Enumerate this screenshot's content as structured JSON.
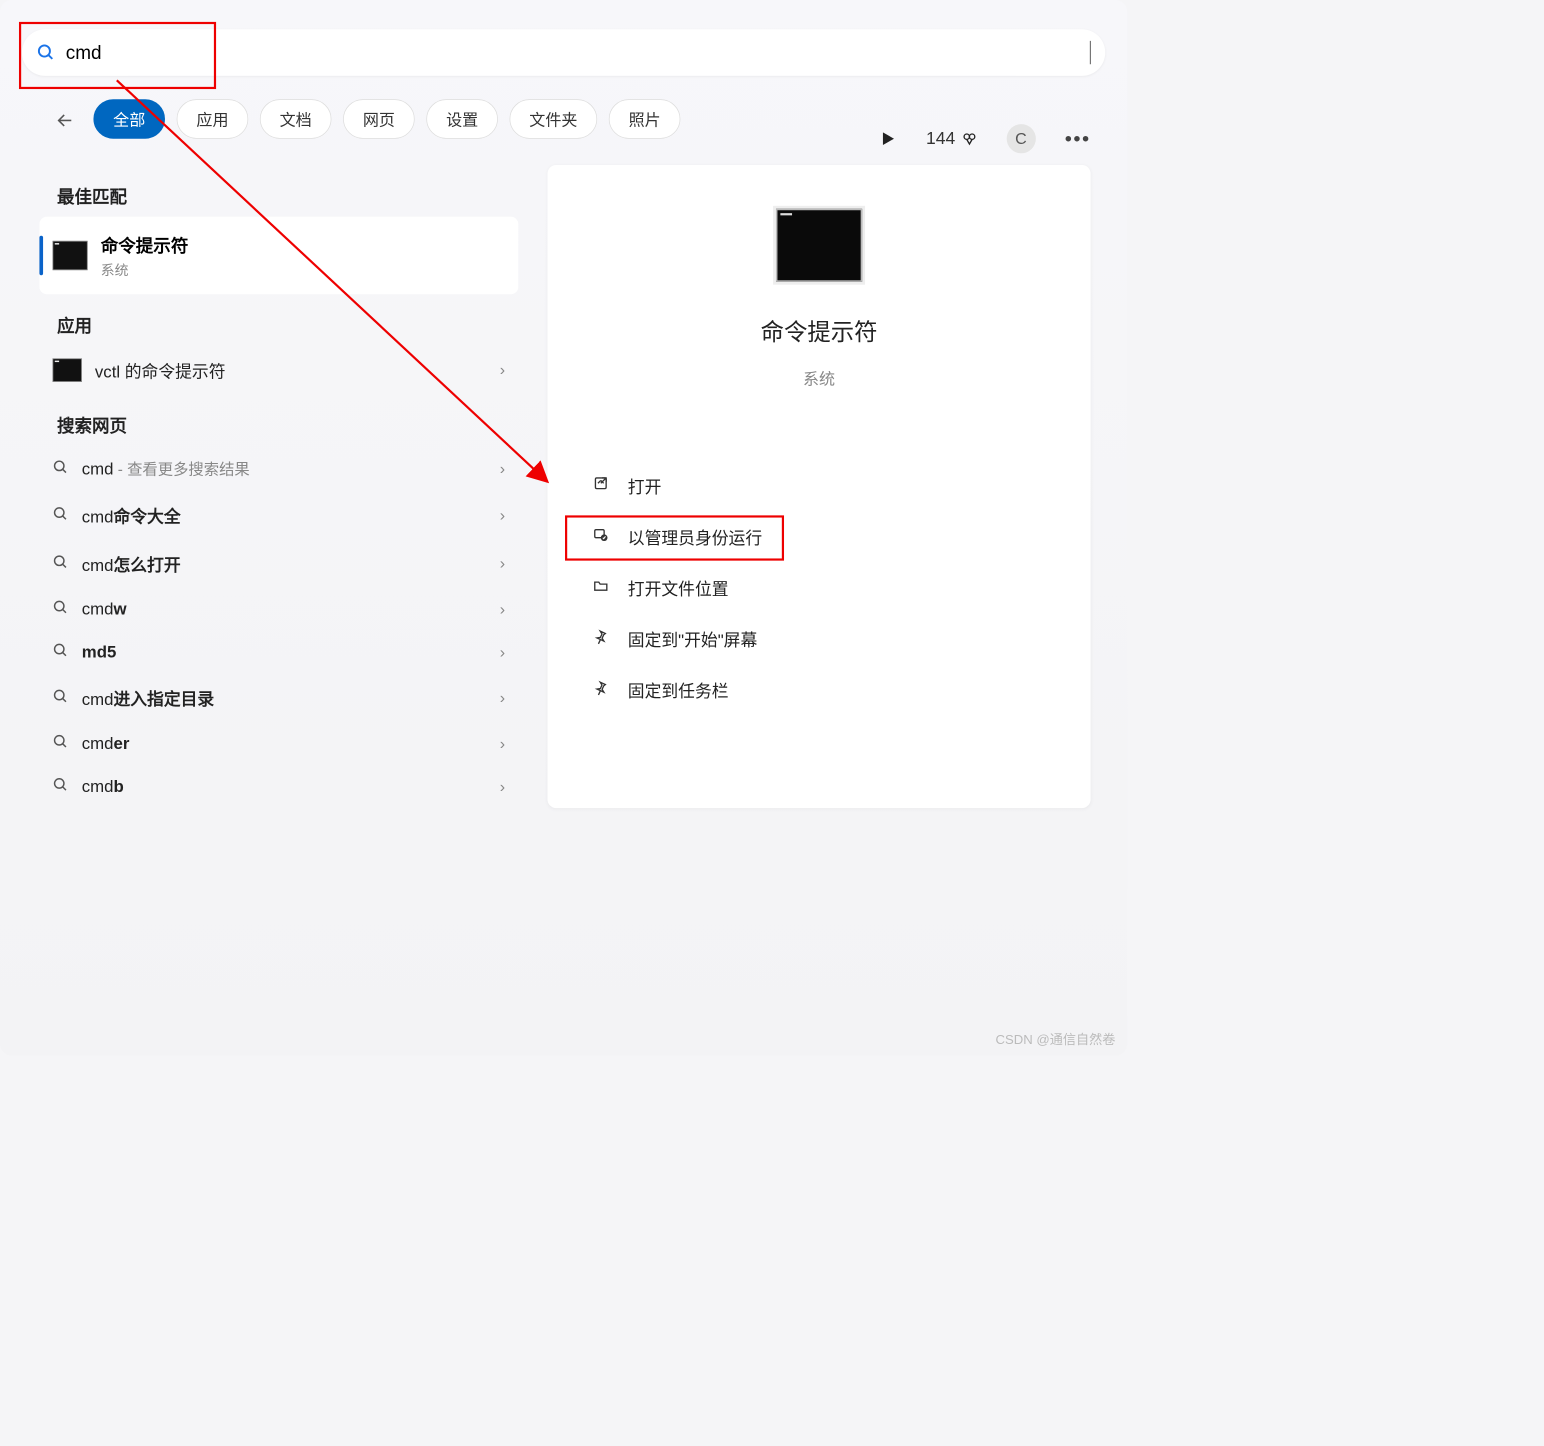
{
  "search": {
    "value": "cmd"
  },
  "filters": {
    "tabs": [
      "全部",
      "应用",
      "文档",
      "网页",
      "设置",
      "文件夹",
      "照片"
    ],
    "active_index": 0
  },
  "topright": {
    "points": "144",
    "avatar_letter": "C"
  },
  "left": {
    "best_match_header": "最佳匹配",
    "best_match": {
      "title": "命令提示符",
      "subtitle": "系统"
    },
    "apps_header": "应用",
    "app_item": {
      "label": "vctl 的命令提示符"
    },
    "web_header": "搜索网页",
    "web_items": [
      {
        "prefix": "cmd",
        "bold": "",
        "suffix": " - 查看更多搜索结果",
        "suffix_gray": true
      },
      {
        "prefix": "cmd",
        "bold": "命令大全",
        "suffix": ""
      },
      {
        "prefix": "cmd",
        "bold": "怎么打开",
        "suffix": ""
      },
      {
        "prefix": "cmd",
        "bold": "w",
        "suffix": ""
      },
      {
        "prefix": "",
        "bold": "md5",
        "suffix": ""
      },
      {
        "prefix": "cmd",
        "bold": "进入指定目录",
        "suffix": ""
      },
      {
        "prefix": "cmd",
        "bold": "er",
        "suffix": ""
      },
      {
        "prefix": "cmd",
        "bold": "b",
        "suffix": ""
      }
    ]
  },
  "right": {
    "title": "命令提示符",
    "subtitle": "系统",
    "actions": [
      {
        "icon": "open",
        "label": "打开"
      },
      {
        "icon": "admin",
        "label": "以管理员身份运行"
      },
      {
        "icon": "folder",
        "label": "打开文件位置"
      },
      {
        "icon": "pin",
        "label": "固定到\"开始\"屏幕"
      },
      {
        "icon": "pin",
        "label": "固定到任务栏"
      }
    ]
  },
  "watermark": "CSDN @通信自然卷"
}
